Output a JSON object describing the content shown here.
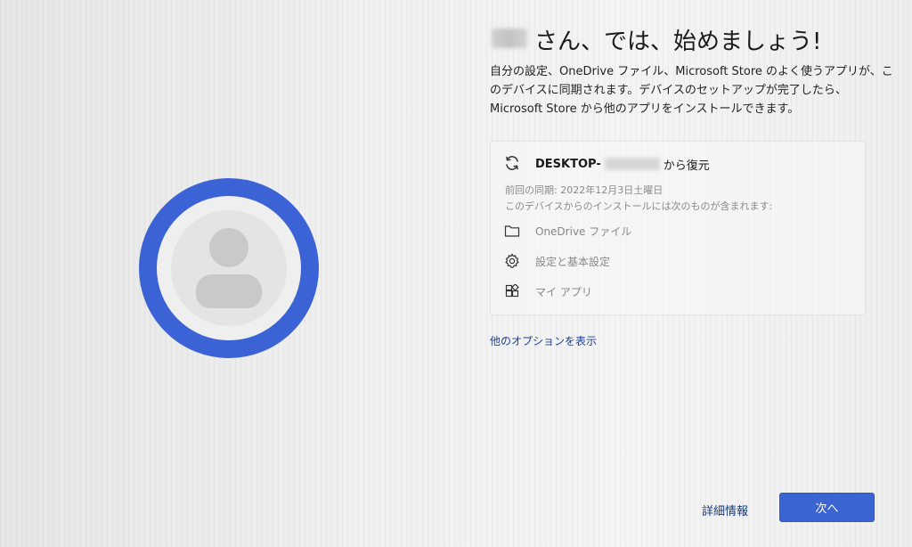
{
  "header": {
    "title": "さん、では、始めましょう!"
  },
  "description": "自分の設定、OneDrive ファイル、Microsoft Store のよく使うアプリが、このデバイスに同期されます。デバイスのセットアップが完了したら、Microsoft Store から他のアプリをインストールできます。",
  "restore_card": {
    "device_prefix": "DESKTOP-",
    "device_suffix": "から復元",
    "last_sync": "前回の同期: 2022年12月3日土曜日",
    "includes_note": "このデバイスからのインストールには次のものが含まれます:",
    "items": [
      {
        "icon": "folder-icon",
        "label": "OneDrive ファイル"
      },
      {
        "icon": "gear-icon",
        "label": "設定と基本設定"
      },
      {
        "icon": "apps-icon",
        "label": "マイ アプリ"
      }
    ]
  },
  "links": {
    "more_options": "他のオプションを表示",
    "details": "詳細情報"
  },
  "buttons": {
    "next": "次へ"
  },
  "colors": {
    "accent": "#3a64cf",
    "ring": "#3b63d6",
    "link": "#1f3f8f"
  }
}
